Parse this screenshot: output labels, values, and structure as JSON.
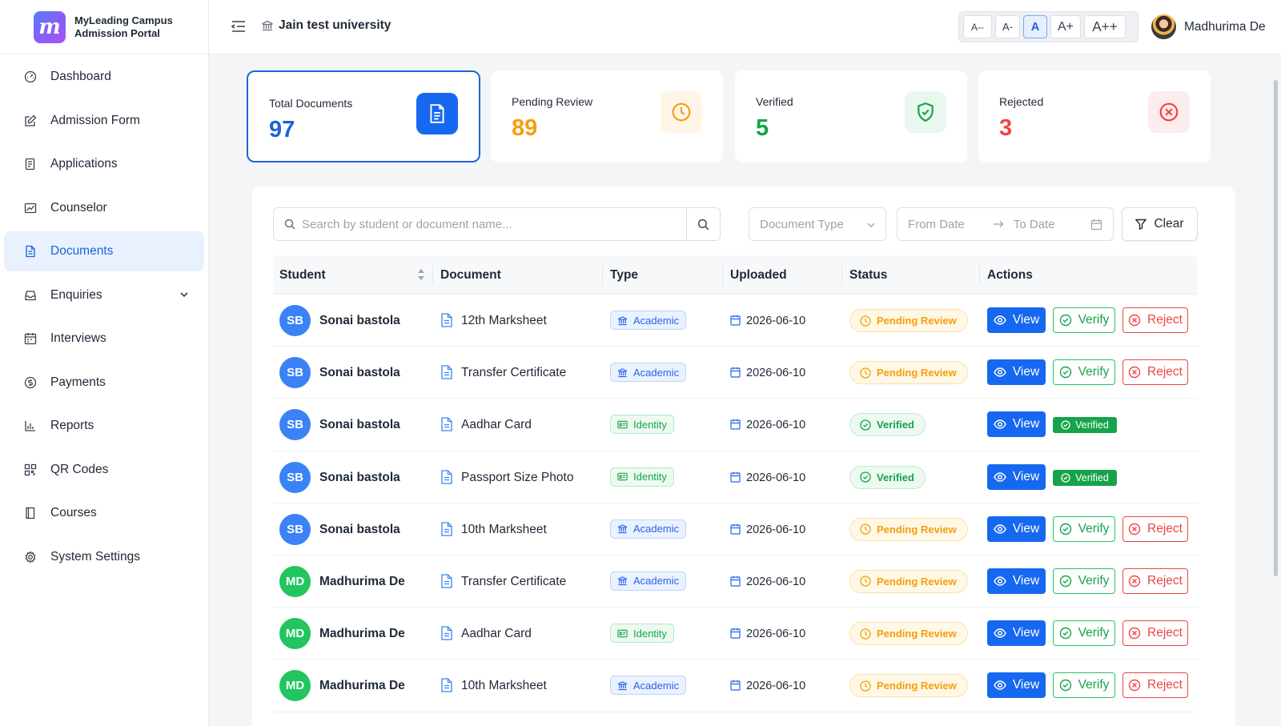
{
  "brand": {
    "line1": "MyLeading Campus",
    "line2": "Admission Portal",
    "logo_letter": "m"
  },
  "sidebar": {
    "items": [
      {
        "label": "Dashboard",
        "icon": "dashboard-icon"
      },
      {
        "label": "Admission Form",
        "icon": "edit-icon"
      },
      {
        "label": "Applications",
        "icon": "file-list-icon"
      },
      {
        "label": "Counselor",
        "icon": "chart-icon"
      },
      {
        "label": "Documents",
        "icon": "document-icon",
        "active": true
      },
      {
        "label": "Enquiries",
        "icon": "inbox-icon",
        "has_submenu": true
      },
      {
        "label": "Interviews",
        "icon": "calendar-icon"
      },
      {
        "label": "Payments",
        "icon": "dollar-icon"
      },
      {
        "label": "Reports",
        "icon": "bar-chart-icon"
      },
      {
        "label": "QR Codes",
        "icon": "qr-code-icon"
      },
      {
        "label": "Courses",
        "icon": "book-icon"
      },
      {
        "label": "System Settings",
        "icon": "gear-icon"
      }
    ]
  },
  "header": {
    "institution": "Jain test university",
    "font_sizes": [
      "A--",
      "A-",
      "A",
      "A+",
      "A++"
    ],
    "font_size_selected": "A",
    "user_name": "Madhurima De"
  },
  "stats": [
    {
      "label": "Total Documents",
      "value": "97",
      "color": "#1d63d8",
      "icon": "document-icon"
    },
    {
      "label": "Pending Review",
      "value": "89",
      "color": "#f59e0b",
      "icon": "clock-icon"
    },
    {
      "label": "Verified",
      "value": "5",
      "color": "#16a34a",
      "icon": "shield-check-icon"
    },
    {
      "label": "Rejected",
      "value": "3",
      "color": "#ef4444",
      "icon": "x-circle-icon"
    }
  ],
  "filters": {
    "search_placeholder": "Search by student or document name...",
    "doc_type_placeholder": "Document Type",
    "from_date_placeholder": "From Date",
    "to_date_placeholder": "To Date",
    "clear_label": "Clear"
  },
  "table": {
    "columns": [
      "Student",
      "Document",
      "Type",
      "Uploaded",
      "Status",
      "Actions"
    ],
    "actions": {
      "view": "View",
      "verify": "Verify",
      "reject": "Reject",
      "verified_tag": "Verified"
    },
    "rows": [
      {
        "initials": "SB",
        "avatar_color": "#3b82f6",
        "student": "Sonai bastola",
        "document": "12th Marksheet",
        "type": "Academic",
        "uploaded": "2026-06-10",
        "status": "Pending Review"
      },
      {
        "initials": "SB",
        "avatar_color": "#3b82f6",
        "student": "Sonai bastola",
        "document": "Transfer Certificate",
        "type": "Academic",
        "uploaded": "2026-06-10",
        "status": "Pending Review"
      },
      {
        "initials": "SB",
        "avatar_color": "#3b82f6",
        "student": "Sonai bastola",
        "document": "Aadhar Card",
        "type": "Identity",
        "uploaded": "2026-06-10",
        "status": "Verified"
      },
      {
        "initials": "SB",
        "avatar_color": "#3b82f6",
        "student": "Sonai bastola",
        "document": "Passport Size Photo",
        "type": "Identity",
        "uploaded": "2026-06-10",
        "status": "Verified"
      },
      {
        "initials": "SB",
        "avatar_color": "#3b82f6",
        "student": "Sonai bastola",
        "document": "10th Marksheet",
        "type": "Academic",
        "uploaded": "2026-06-10",
        "status": "Pending Review"
      },
      {
        "initials": "MD",
        "avatar_color": "#22c55e",
        "student": "Madhurima De",
        "document": "Transfer Certificate",
        "type": "Academic",
        "uploaded": "2026-06-10",
        "status": "Pending Review"
      },
      {
        "initials": "MD",
        "avatar_color": "#22c55e",
        "student": "Madhurima De",
        "document": "Aadhar Card",
        "type": "Identity",
        "uploaded": "2026-06-10",
        "status": "Pending Review"
      },
      {
        "initials": "MD",
        "avatar_color": "#22c55e",
        "student": "Madhurima De",
        "document": "10th Marksheet",
        "type": "Academic",
        "uploaded": "2026-06-10",
        "status": "Pending Review"
      }
    ]
  }
}
